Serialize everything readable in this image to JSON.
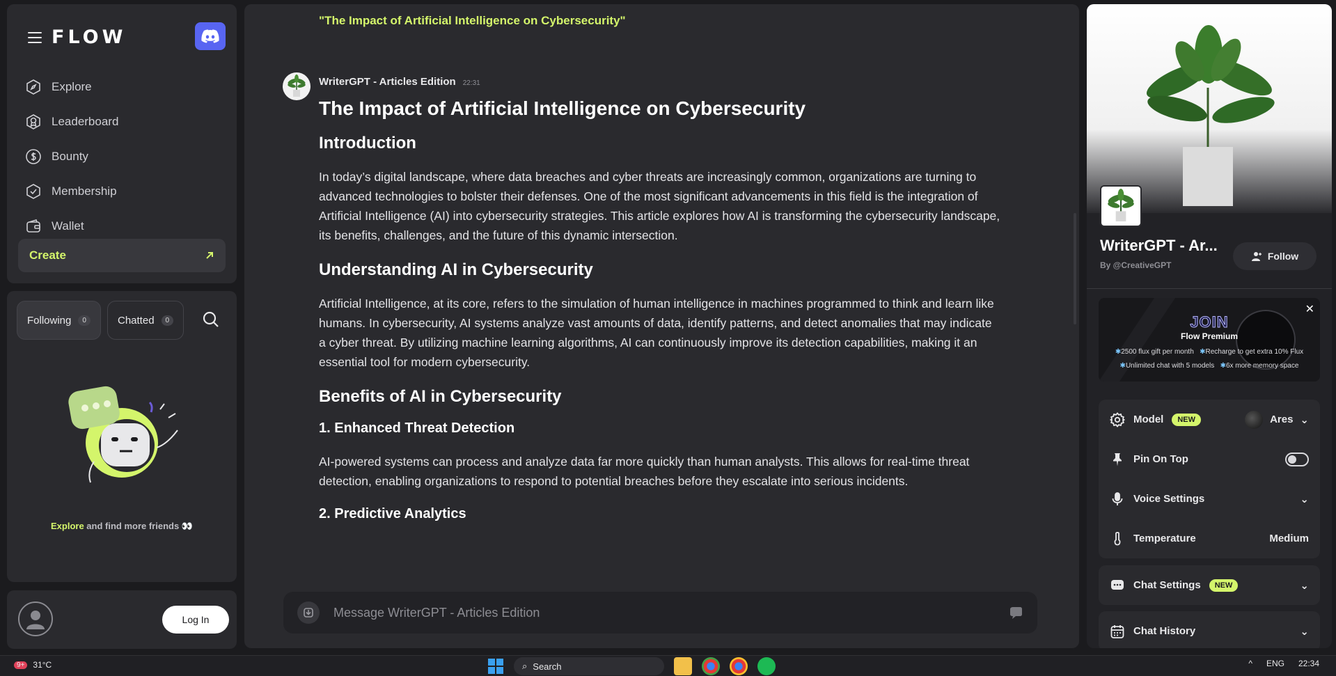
{
  "sidebar": {
    "logo": "FLOW",
    "nav": [
      {
        "label": "Explore",
        "icon": "compass-icon"
      },
      {
        "label": "Leaderboard",
        "icon": "medal-icon"
      },
      {
        "label": "Bounty",
        "icon": "dollar-icon"
      },
      {
        "label": "Membership",
        "icon": "badge-icon"
      },
      {
        "label": "Wallet",
        "icon": "wallet-icon"
      }
    ],
    "create_label": "Create",
    "tabs": [
      {
        "label": "Following",
        "count": "0"
      },
      {
        "label": "Chatted",
        "count": "0"
      }
    ],
    "explore_prefix": "Explore",
    "explore_suffix": "and find more friends 👀",
    "login_label": "Log In"
  },
  "chat": {
    "previous_quote": "\"The Impact of Artificial Intelligence on Cybersecurity\"",
    "bot_name": "WriterGPT - Articles Edition",
    "time": "22:31",
    "article": {
      "title": "The Impact of Artificial Intelligence on Cybersecurity",
      "h_intro": "Introduction",
      "p_intro": "In today’s digital landscape, where data breaches and cyber threats are increasingly common, organizations are turning to advanced technologies to bolster their defenses. One of the most significant advancements in this field is the integration of Artificial Intelligence (AI) into cybersecurity strategies. This article explores how AI is transforming the cybersecurity landscape, its benefits, challenges, and the future of this dynamic intersection.",
      "h_understanding": "Understanding AI in Cybersecurity",
      "p_understanding": "Artificial Intelligence, at its core, refers to the simulation of human intelligence in machines programmed to think and learn like humans. In cybersecurity, AI systems analyze vast amounts of data, identify patterns, and detect anomalies that may indicate a cyber threat. By utilizing machine learning algorithms, AI can continuously improve its detection capabilities, making it an essential tool for modern cybersecurity.",
      "h_benefits": "Benefits of AI in Cybersecurity",
      "h_threat": "1. Enhanced Threat Detection",
      "p_threat": "AI-powered systems can process and analyze data far more quickly than human analysts. This allows for real-time threat detection, enabling organizations to respond to potential breaches before they escalate into serious incidents.",
      "h_predictive": "2. Predictive Analytics"
    },
    "input_placeholder": "Message WriterGPT - Articles Edition"
  },
  "bot_panel": {
    "title": "WriterGPT - Ar...",
    "by": "By @CreativeGPT",
    "follow_label": "Follow",
    "promo": {
      "join": "JOIN",
      "title": "Flow Premium",
      "line1a": "2500 flux gift per month",
      "line1b": "Recharge to get extra 10% Flux",
      "line2a": "Unlimited chat with 5 models",
      "line2b": "6x more memory space"
    },
    "settings": {
      "model_label": "Model",
      "model_badge": "NEW",
      "model_value": "Ares",
      "pin_label": "Pin On Top",
      "voice_label": "Voice Settings",
      "temp_label": "Temperature",
      "temp_value": "Medium",
      "chat_settings_label": "Chat Settings",
      "chat_settings_badge": "NEW",
      "history_label": "Chat History"
    }
  },
  "taskbar": {
    "weather": "31°C",
    "notif_count": "9+",
    "search_label": "Search",
    "lang": "ENG",
    "time": "22:34"
  },
  "colors": {
    "accent": "#d4f56b",
    "discord": "#5865f2",
    "panel": "#2a2a2e",
    "background": "#1b1b1e"
  }
}
